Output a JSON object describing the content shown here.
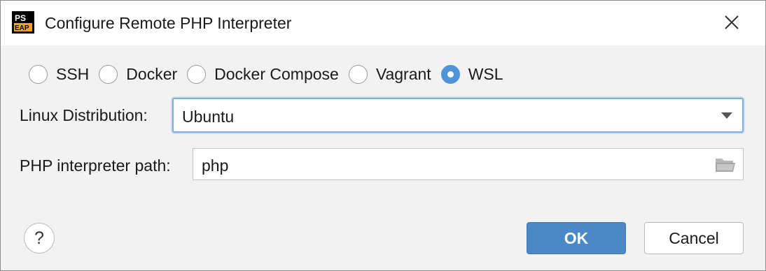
{
  "window": {
    "title": "Configure Remote PHP Interpreter",
    "app_logo_text_top": "PS",
    "app_logo_text_bottom": "EAP"
  },
  "connection_types": {
    "selected": "WSL",
    "options": [
      "SSH",
      "Docker",
      "Docker Compose",
      "Vagrant",
      "WSL"
    ]
  },
  "linux_distribution": {
    "label": "Linux Distribution:",
    "value": "Ubuntu"
  },
  "php_path": {
    "label": "PHP interpreter path:",
    "value": "php"
  },
  "footer": {
    "help_label": "?",
    "ok_label": "OK",
    "cancel_label": "Cancel"
  },
  "colors": {
    "accent": "#4f94d8",
    "ok_button": "#4a88c7",
    "focus_border": "#80b0e3",
    "dialog_background": "#f2f2f2"
  }
}
